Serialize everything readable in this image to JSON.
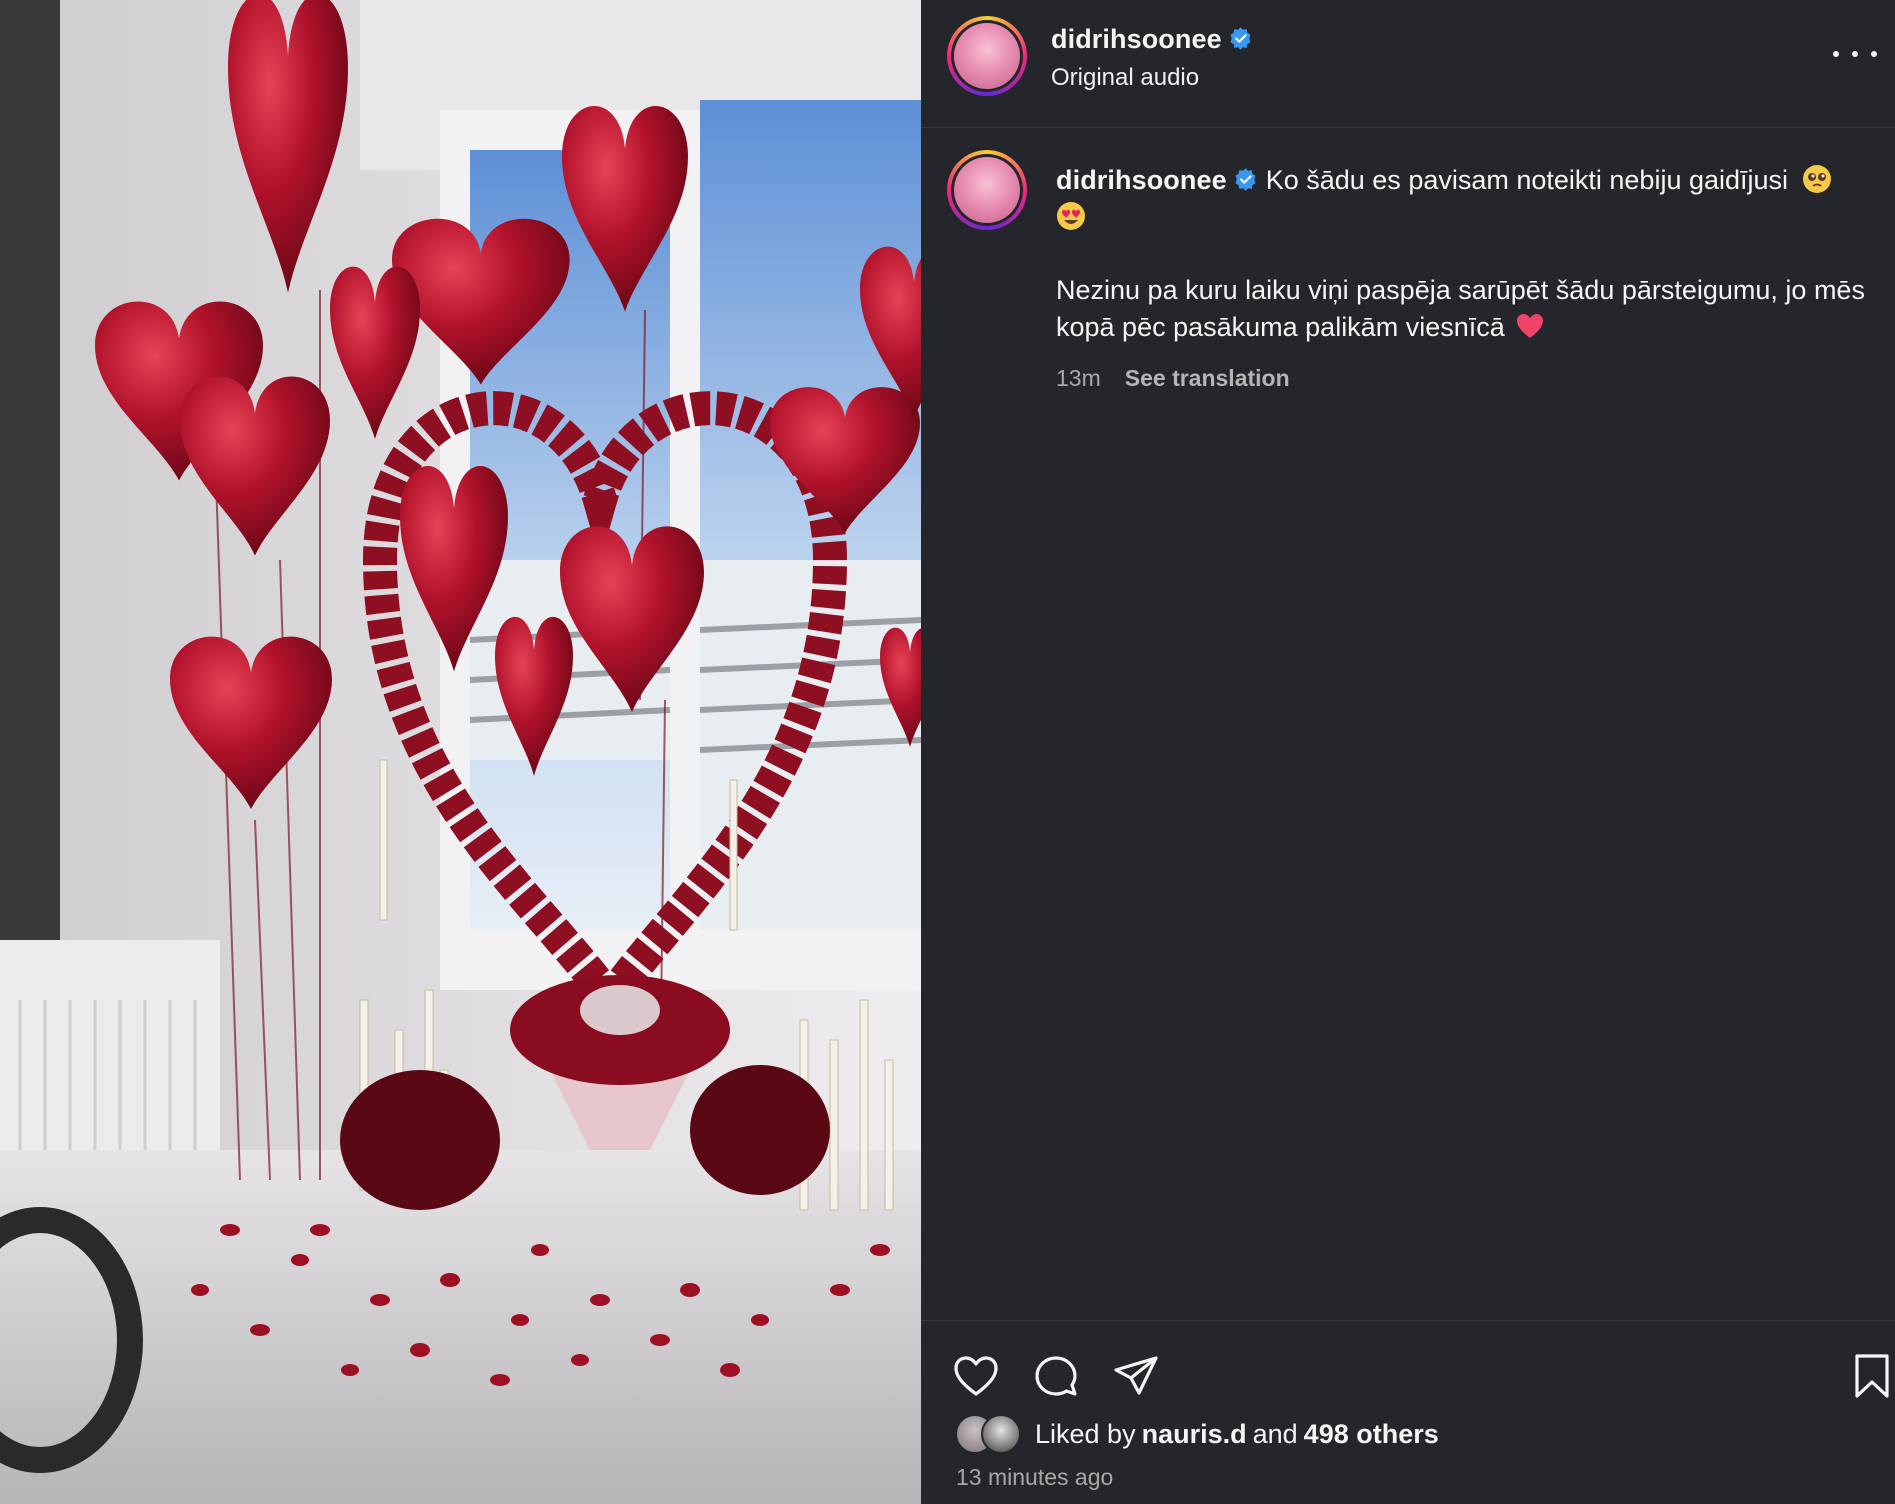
{
  "post": {
    "username": "didrihsoonee",
    "audio": "Original audio",
    "more_icon": "more-horizontal-icon"
  },
  "caption": {
    "username": "didrihsoonee",
    "line1": "Ko šādu es pavisam noteikti nebiju gaidījusi",
    "line2": "Nezinu pa kuru laiku viņi paspēja sarūpēt šādu pārsteigumu, jo mēs kopā pēc pasākuma palikām viesnīcā",
    "emojis": [
      "pleading-face",
      "heart-eyes-face",
      "red-heart"
    ],
    "time": "13m",
    "see_translation": "See translation"
  },
  "actions": {
    "icons": [
      "heart-icon",
      "comment-icon",
      "share-icon",
      "bookmark-icon"
    ]
  },
  "likes": {
    "prefix": "Liked by",
    "user": "nauris.d",
    "and": "and",
    "others": "498 others"
  },
  "timestamp": "13 minutes ago",
  "colors": {
    "background": "#25262b",
    "verified": "#3897f0",
    "text_secondary": "#a8a8a8"
  }
}
